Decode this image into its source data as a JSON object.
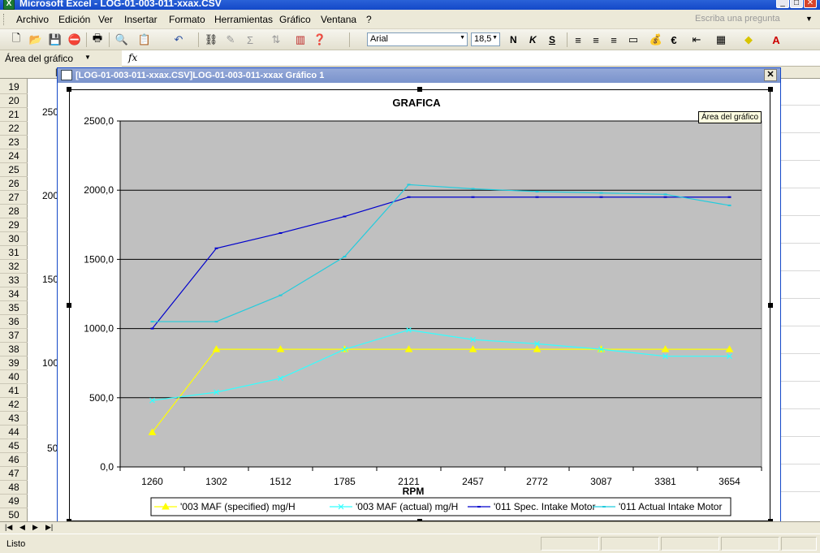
{
  "app": {
    "title": "Microsoft Excel - LOG-01-003-011-xxax.CSV",
    "icon": "excel-icon"
  },
  "menu": {
    "items": [
      "Archivo",
      "Edición",
      "Ver",
      "Insertar",
      "Formato",
      "Herramientas",
      "Gráfico",
      "Ventana",
      "?"
    ],
    "ask_placeholder": "Escriba una pregunta"
  },
  "toolbar": {
    "font": "Arial",
    "size": "18,5",
    "bold": "N",
    "italic": "K",
    "underline": "S"
  },
  "formula_bar": {
    "name_box": "Área del gráfico",
    "fx": "fx"
  },
  "sheet": {
    "rows": [
      "19",
      "20",
      "21",
      "22",
      "23",
      "24",
      "25",
      "26",
      "27",
      "28",
      "29",
      "30",
      "31",
      "32",
      "33",
      "34",
      "35",
      "36",
      "37",
      "38",
      "39",
      "40",
      "41",
      "42",
      "43",
      "44",
      "45",
      "46",
      "47",
      "48",
      "49",
      "50"
    ],
    "background_labels": [
      "250",
      "200",
      "150",
      "100",
      "50"
    ]
  },
  "chart_window": {
    "title": "[LOG-01-003-011-xxax.CSV]LOG-01-003-011-xxax Gráfico 1",
    "tooltip": "Área del gráfico"
  },
  "chart_data": {
    "type": "line",
    "title": "GRAFICA",
    "xlabel": "RPM",
    "ylabel": "",
    "categories": [
      "1260",
      "1302",
      "1512",
      "1785",
      "2121",
      "2457",
      "2772",
      "3087",
      "3381",
      "3654"
    ],
    "ylim": [
      0,
      2500
    ],
    "yticks": [
      0,
      500,
      1000,
      1500,
      2000,
      2500
    ],
    "ytick_labels": [
      "0,0",
      "500,0",
      "1000,0",
      "1500,0",
      "2000,0",
      "2500,0"
    ],
    "grid": true,
    "plot_background": "#c0c0c0",
    "legend_position": "bottom",
    "series": [
      {
        "name": "'003 MAF (specified) mg/H",
        "color": "#ffff00",
        "marker": "triangle",
        "values": [
          250,
          850,
          850,
          850,
          850,
          850,
          850,
          850,
          850,
          850
        ]
      },
      {
        "name": "'003 MAF (actual) mg/H",
        "color": "#33ffff",
        "marker": "x",
        "values": [
          480,
          540,
          640,
          850,
          990,
          920,
          890,
          850,
          800,
          800
        ]
      },
      {
        "name": "'011 Spec. Intake Motor",
        "color": "#0000cc",
        "marker": "dash",
        "values": [
          1000,
          1580,
          1690,
          1810,
          1950,
          1950,
          1950,
          1950,
          1950,
          1950
        ]
      },
      {
        "name": "'011 Actual Intake Motor",
        "color": "#22ccdd",
        "marker": "dash",
        "values": [
          1050,
          1050,
          1240,
          1520,
          2040,
          2010,
          1990,
          1980,
          1970,
          1890
        ]
      }
    ]
  },
  "status": {
    "text": "Listo"
  }
}
